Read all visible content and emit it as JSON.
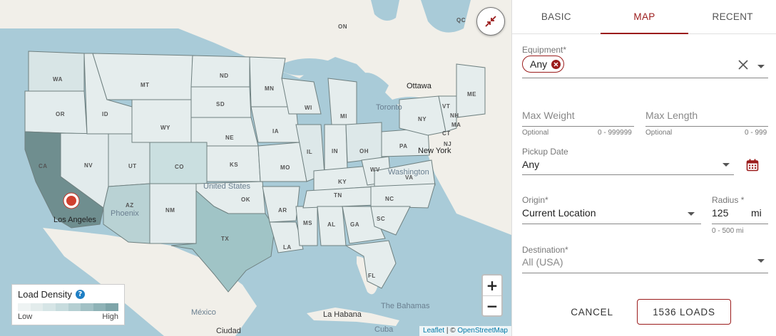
{
  "map": {
    "states": [
      "WA",
      "OR",
      "CA",
      "NV",
      "ID",
      "MT",
      "WY",
      "UT",
      "AZ",
      "CO",
      "NM",
      "ND",
      "SD",
      "NE",
      "KS",
      "OK",
      "TX",
      "MN",
      "IA",
      "MO",
      "AR",
      "LA",
      "WI",
      "IL",
      "MS",
      "MI",
      "IN",
      "KY",
      "TN",
      "AL",
      "OH",
      "WV",
      "GA",
      "PA",
      "VA",
      "NC",
      "SC",
      "FL",
      "NY",
      "VT",
      "NH",
      "ME",
      "MA",
      "CT",
      "NJ",
      "QC",
      "ON"
    ],
    "cities": {
      "los_angeles": "Los Angeles",
      "phoenix": "Phoenix",
      "ottawa": "Ottawa",
      "toronto": "Toronto",
      "new_york": "New York",
      "washington": "Washington",
      "united_states": "United States",
      "mexico": "México",
      "la_habana": "La Habana",
      "the_bahamas": "The Bahamas",
      "cuba": "Cuba",
      "ciudad": "Ciudad"
    },
    "legend": {
      "title": "Load Density",
      "low": "Low",
      "high": "High",
      "colors": [
        "#eef3f3",
        "#e3ecec",
        "#d6e5e6",
        "#c7dcde",
        "#b5cfd2",
        "#a2c1c5",
        "#8fb3b7",
        "#7ea5a9"
      ]
    },
    "zoom_in": "+",
    "zoom_out": "−",
    "attribution": {
      "leaflet": "Leaflet",
      "sep": " | © ",
      "osm": "OpenStreetMap"
    }
  },
  "panel": {
    "tabs": [
      {
        "label": "BASIC"
      },
      {
        "label": "MAP"
      },
      {
        "label": "RECENT"
      }
    ],
    "equipment": {
      "label": "Equipment*",
      "chip": "Any"
    },
    "max_weight": {
      "placeholder": "Max Weight",
      "hint_left": "Optional",
      "hint_right": "0 - 999999"
    },
    "max_length": {
      "placeholder": "Max Length",
      "hint_left": "Optional",
      "hint_right": "0 - 999"
    },
    "pickup_date": {
      "label": "Pickup Date",
      "value": "Any"
    },
    "origin": {
      "label": "Origin*",
      "value": "Current Location"
    },
    "radius": {
      "label": "Radius *",
      "value": "125",
      "unit": "mi",
      "hint": "0 - 500 mi"
    },
    "destination": {
      "label": "Destination*",
      "value": "All (USA)"
    },
    "cancel_label": "CANCEL",
    "loads_label": "1536 LOADS"
  },
  "colors": {
    "accent": "#9b1c1c",
    "water": "#a9cbd8",
    "state_fill": "#e4eeee",
    "california": "#6f8e8f"
  }
}
